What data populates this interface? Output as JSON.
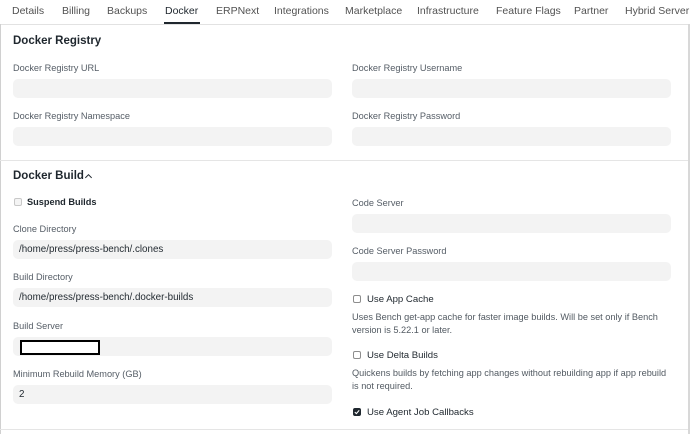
{
  "tabs": [
    {
      "label": "Details"
    },
    {
      "label": "Billing"
    },
    {
      "label": "Backups"
    },
    {
      "label": "Docker",
      "active": true
    },
    {
      "label": "ERPNext"
    },
    {
      "label": "Integrations"
    },
    {
      "label": "Marketplace"
    },
    {
      "label": "Infrastructure"
    },
    {
      "label": "Feature Flags"
    },
    {
      "label": "Partner"
    },
    {
      "label": "Hybrid Server"
    }
  ],
  "registry": {
    "title": "Docker Registry",
    "url_label": "Docker Registry URL",
    "url_value": "",
    "username_label": "Docker Registry Username",
    "username_value": "",
    "namespace_label": "Docker Registry Namespace",
    "namespace_value": "",
    "password_label": "Docker Registry Password",
    "password_value": ""
  },
  "build": {
    "title": "Docker Build",
    "collapse_icon": "chevron-up-icon",
    "suspend_builds_label": "Suspend Builds",
    "suspend_builds_checked": false,
    "clone_directory_label": "Clone Directory",
    "clone_directory_value": "/home/press/press-bench/.clones",
    "build_directory_label": "Build Directory",
    "build_directory_value": "/home/press/press-bench/.docker-builds",
    "build_server_label": "Build Server",
    "build_server_value": "",
    "min_memory_label": "Minimum Rebuild Memory (GB)",
    "min_memory_value": "2",
    "code_server_label": "Code Server",
    "code_server_value": "",
    "code_server_password_label": "Code Server Password",
    "code_server_password_value": "",
    "use_app_cache_label": "Use App Cache",
    "use_app_cache_checked": false,
    "use_app_cache_desc": "Uses Bench get-app cache for faster image builds. Will be set only if Bench version is 5.22.1 or later.",
    "use_delta_builds_label": "Use Delta Builds",
    "use_delta_builds_checked": false,
    "use_delta_builds_desc": "Quickens builds by fetching app changes without rebuilding app if app rebuild is not required.",
    "agent_callbacks_label": "Use Agent Job Callbacks",
    "agent_callbacks_checked": true
  },
  "colors": {
    "text": "#1f272e",
    "muted": "#555d66",
    "input_bg": "#f3f3f3",
    "border": "#e2e2e2"
  }
}
